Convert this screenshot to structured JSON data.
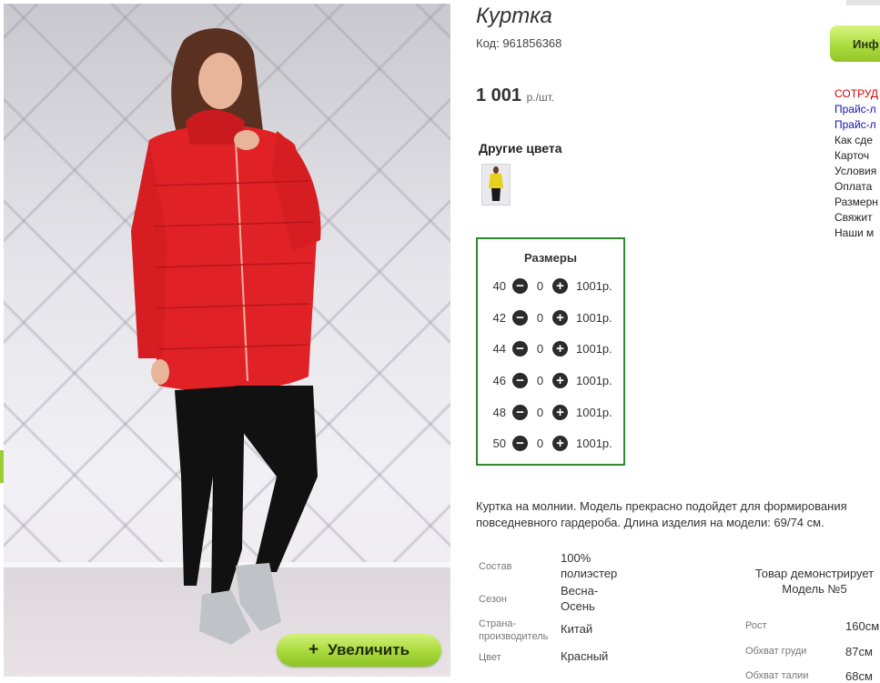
{
  "product": {
    "title": "Куртка",
    "code": "Код: 961856368",
    "price": "1 001",
    "price_unit": "р./шт.",
    "other_colors_label": "Другие цвета",
    "zoom_button": "Увеличить",
    "zoom_plus": "+"
  },
  "sizes": {
    "title": "Размеры",
    "rows": [
      {
        "size": "40",
        "qty": "0",
        "price": "1001р."
      },
      {
        "size": "42",
        "qty": "0",
        "price": "1001р."
      },
      {
        "size": "44",
        "qty": "0",
        "price": "1001р."
      },
      {
        "size": "46",
        "qty": "0",
        "price": "1001р."
      },
      {
        "size": "48",
        "qty": "0",
        "price": "1001р."
      },
      {
        "size": "50",
        "qty": "0",
        "price": "1001р."
      }
    ]
  },
  "description": {
    "line1": "Куртка на молнии. Модель прекрасно подойдет для формирования",
    "line2": "повседневного гардероба. Длина изделия на модели: 69/74 см."
  },
  "properties": [
    {
      "label": "Состав",
      "value_line1": "100%",
      "value_line2": "полиэстер"
    },
    {
      "label": "Сезон",
      "value_line1": "Весна-",
      "value_line2": "Осень"
    },
    {
      "label_line1": "Страна-",
      "label_line2": "производитель",
      "value": "Китай"
    },
    {
      "label": "Цвет",
      "value": "Красный"
    }
  ],
  "model": {
    "heading_line1": "Товар демонстрирует",
    "heading_line2": "Модель №5",
    "params": [
      {
        "label": "Рост",
        "value": "160см"
      },
      {
        "label": "Обхват груди",
        "value": "87см"
      },
      {
        "label": "Обхват талии",
        "value": "68см"
      }
    ]
  },
  "sidebar": {
    "info_button": "Инф",
    "links": [
      {
        "text": "СОТРУД",
        "color": "red"
      },
      {
        "text": "Прайс-л",
        "color": "blue"
      },
      {
        "text": "Прайс-л",
        "color": "blue"
      },
      {
        "text": "Как сде",
        "color": "dark"
      },
      {
        "text": "Карточ",
        "color": "dark"
      },
      {
        "text": "Условия",
        "color": "dark"
      },
      {
        "text": "Оплата",
        "color": "dark"
      },
      {
        "text": "Размерн",
        "color": "dark"
      },
      {
        "text": "Свяжит",
        "color": "dark"
      },
      {
        "text": "Наши м",
        "color": "dark"
      }
    ]
  },
  "colors": {
    "accent_green": "#a6d83a",
    "sizes_border": "#2b8a2b",
    "jacket_red": "#e02226",
    "link_red": "#d40000",
    "link_blue": "#1010c0"
  }
}
